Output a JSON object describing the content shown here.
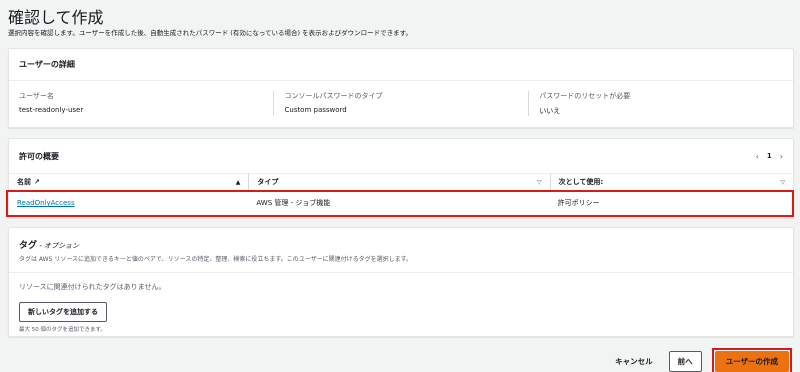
{
  "header": {
    "title": "確認して作成",
    "description": "選択内容を確認します。ユーザーを作成した後、自動生成されたパスワード (有効になっている場合) を表示およびダウンロードできます。"
  },
  "user_details": {
    "title": "ユーザーの詳細",
    "fields": [
      {
        "label": "ユーザー名",
        "value": "test-readonly-user"
      },
      {
        "label": "コンソールパスワードのタイプ",
        "value": "Custom password"
      },
      {
        "label": "パスワードのリセットが必要",
        "value": "いいえ"
      }
    ]
  },
  "permissions": {
    "title": "許可の概要",
    "page": "1",
    "columns": [
      "名前",
      "タイプ",
      "次として使用:"
    ],
    "rows": [
      {
        "name": "ReadOnlyAccess",
        "type": "AWS 管理 - ジョブ機能",
        "used_as": "許可ポリシー"
      }
    ]
  },
  "tags": {
    "title": "タグ",
    "optional": " - オプション",
    "description": "タグは AWS リソースに追加できるキーと値のペアで、リソースの特定、整理、検索に役立ちます。このユーザーに関連付けるタグを選択します。",
    "empty": "リソースに関連付けられたタグはありません。",
    "add_button": "新しいタグを追加する",
    "limit": "最大 50 個のタグを追加できます。"
  },
  "footer": {
    "cancel": "キャンセル",
    "previous": "前へ",
    "create": "ユーザーの作成"
  },
  "colors": {
    "primary_button": "#ec7211",
    "link": "#0073bb",
    "highlight": "#d91a1a"
  }
}
